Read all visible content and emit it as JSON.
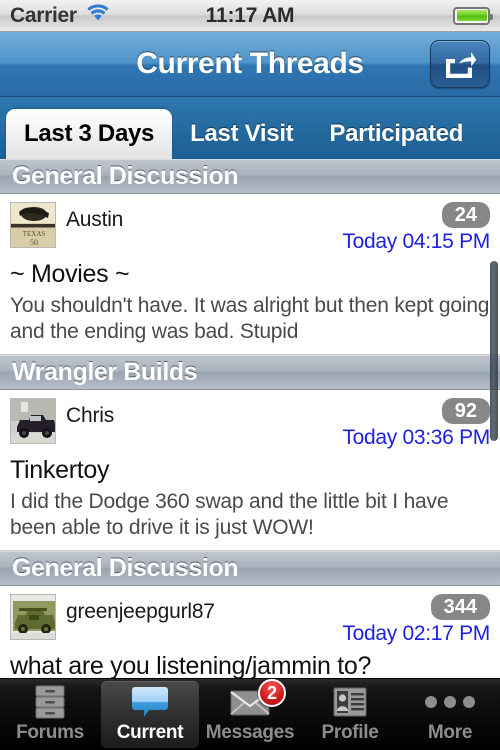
{
  "status_bar": {
    "carrier": "Carrier",
    "time": "11:17 AM",
    "wifi_icon": "wifi-icon",
    "battery_icon": "battery-icon",
    "battery_level_percent": 100
  },
  "nav_bar": {
    "title": "Current Threads",
    "share_icon": "share-icon"
  },
  "segments": {
    "selected": "Last 3 Days",
    "items": [
      {
        "label": "Last 3 Days",
        "active": true
      },
      {
        "label": "Last Visit",
        "active": false
      },
      {
        "label": "Participated",
        "active": false
      }
    ]
  },
  "threads": [
    {
      "section": "General Discussion",
      "author": "Austin",
      "avatar_icon": "avatar-vintage-texas",
      "count": "24",
      "time": "Today 04:15 PM",
      "title": "~ Movies ~",
      "preview": "You shouldn't have.    It was alright but then kept going and the ending was bad.    Stupid"
    },
    {
      "section": "Wrangler Builds",
      "author": "Chris",
      "avatar_icon": "avatar-dark-jeep",
      "count": "92",
      "time": "Today 03:36 PM",
      "title": "Tinkertoy",
      "preview": "I did the Dodge 360 swap and the little bit I have been able to drive it is just WOW!"
    },
    {
      "section": "General Discussion",
      "author": "greenjeepgurl87",
      "avatar_icon": "avatar-green-jeep",
      "count": "344",
      "time": "Today 02:17 PM",
      "title": "what are you listening/jammin to?",
      "preview": ""
    }
  ],
  "tab_bar": {
    "items": [
      {
        "label": "Forums",
        "icon": "file-cabinet-icon",
        "active": false,
        "badge": ""
      },
      {
        "label": "Current",
        "icon": "speech-bubble-icon",
        "active": true,
        "badge": ""
      },
      {
        "label": "Messages",
        "icon": "envelope-icon",
        "active": false,
        "badge": "2"
      },
      {
        "label": "Profile",
        "icon": "contact-card-icon",
        "active": false,
        "badge": ""
      },
      {
        "label": "More",
        "icon": "ellipsis-icon",
        "active": false,
        "badge": ""
      }
    ]
  },
  "colors": {
    "nav_blue": "#2f77b4",
    "segment_blue": "#1d5e92",
    "link_blue": "#1e22e0",
    "badge_gray": "#878787",
    "badge_red": "#d01818",
    "tab_bar_black": "#000000"
  }
}
